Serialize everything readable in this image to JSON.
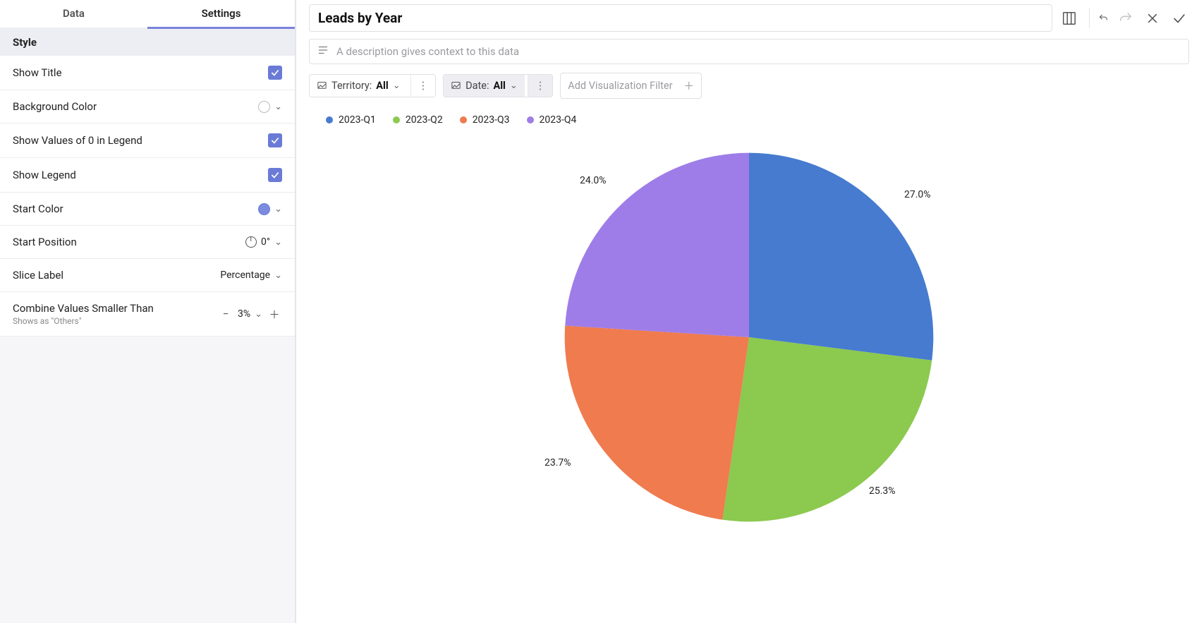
{
  "sidebar": {
    "tabs": {
      "data": "Data",
      "settings": "Settings",
      "active": "settings"
    },
    "section": "Style",
    "show_title": {
      "label": "Show Title",
      "checked": true
    },
    "bg_color": {
      "label": "Background Color",
      "swatch": "#ffffff"
    },
    "show_zero": {
      "label": "Show Values of 0 in Legend",
      "checked": true
    },
    "show_legend": {
      "label": "Show Legend",
      "checked": true
    },
    "start_color": {
      "label": "Start Color",
      "swatch": "#7a8be0"
    },
    "start_position": {
      "label": "Start Position",
      "value": "0°"
    },
    "slice_label": {
      "label": "Slice Label",
      "value": "Percentage"
    },
    "combine": {
      "label": "Combine Values Smaller Than",
      "sublabel": "Shows as \"Others\"",
      "value": "3%"
    }
  },
  "header": {
    "title": "Leads by Year",
    "description_placeholder": "A description gives context to this data"
  },
  "filters": {
    "territory": {
      "label": "Territory:",
      "value": "All"
    },
    "date": {
      "label": "Date:",
      "value": "All"
    },
    "add": "Add Visualization Filter"
  },
  "legend": [
    {
      "label": "2023-Q1",
      "color": "#467bd0"
    },
    {
      "label": "2023-Q2",
      "color": "#8cc94f"
    },
    {
      "label": "2023-Q3",
      "color": "#ef7b4f"
    },
    {
      "label": "2023-Q4",
      "color": "#9e7de8"
    }
  ],
  "slice_labels": {
    "q1": "27.0%",
    "q2": "25.3%",
    "q3": "23.7%",
    "q4": "24.0%"
  },
  "chart_data": {
    "type": "pie",
    "title": "Leads by Year",
    "categories": [
      "2023-Q1",
      "2023-Q2",
      "2023-Q3",
      "2023-Q4"
    ],
    "values": [
      27.0,
      25.3,
      23.7,
      24.0
    ],
    "colors": [
      "#467bd0",
      "#8cc94f",
      "#ef7b4f",
      "#9e7de8"
    ],
    "start_angle_deg": 0,
    "label_mode": "percentage"
  }
}
